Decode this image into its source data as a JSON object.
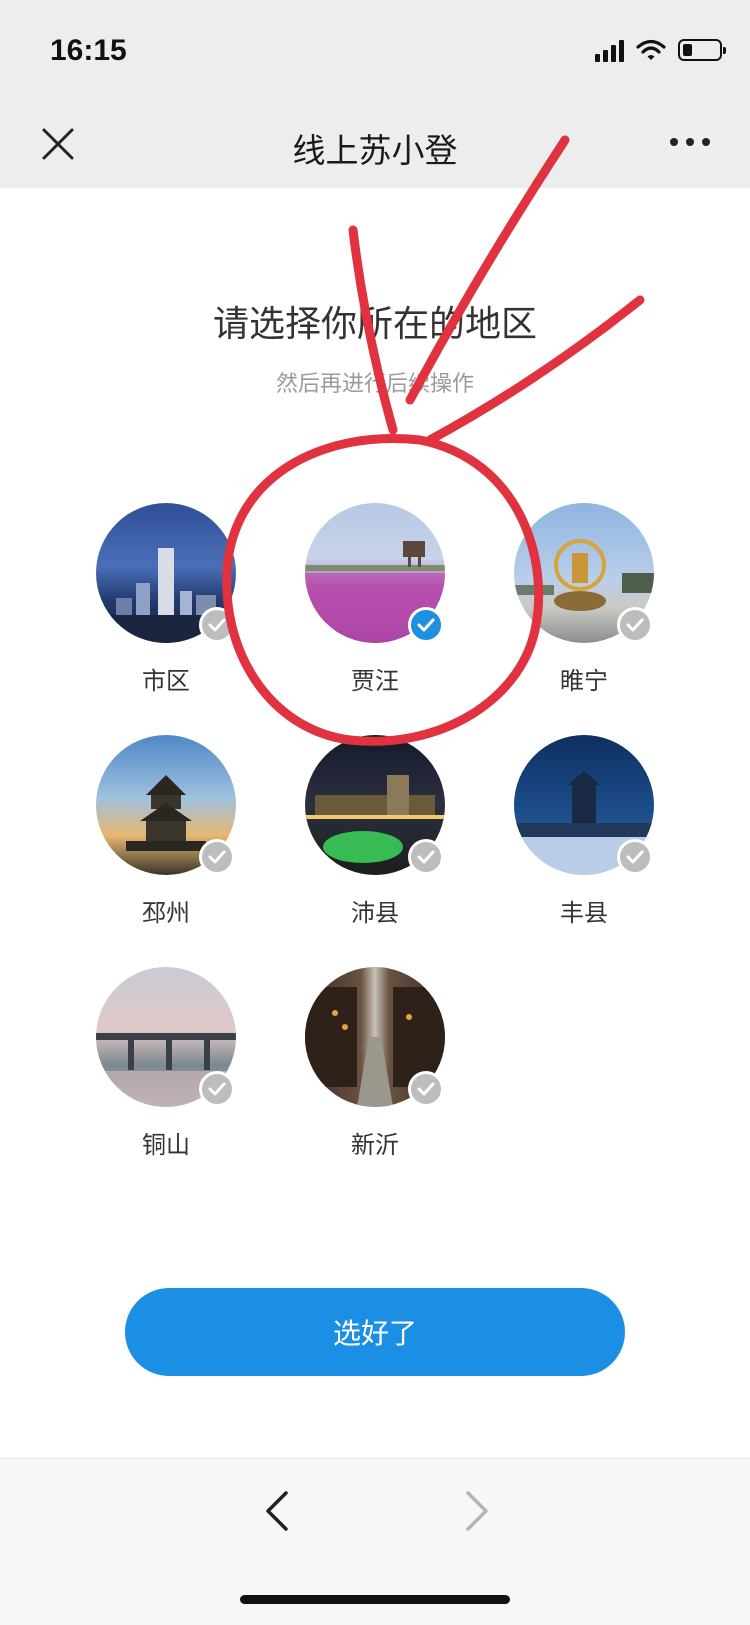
{
  "status_bar": {
    "time": "16:15"
  },
  "nav": {
    "title": "线上苏小登",
    "close_icon": "close-icon",
    "more_icon": "more-icon"
  },
  "page": {
    "title": "请选择你所在的地区",
    "subtitle": "然后再进行后续操作"
  },
  "regions": [
    {
      "label": "市区",
      "selected": false
    },
    {
      "label": "贾汪",
      "selected": true
    },
    {
      "label": "睢宁",
      "selected": false
    },
    {
      "label": "邳州",
      "selected": false
    },
    {
      "label": "沛县",
      "selected": false
    },
    {
      "label": "丰县",
      "selected": false
    },
    {
      "label": "铜山",
      "selected": false
    },
    {
      "label": "新沂",
      "selected": false
    }
  ],
  "confirm_button": {
    "label": "选好了"
  },
  "colors": {
    "accent": "#1b8fe3",
    "check_unselected": "#bdbdbd",
    "annotation": "#e0323f"
  }
}
